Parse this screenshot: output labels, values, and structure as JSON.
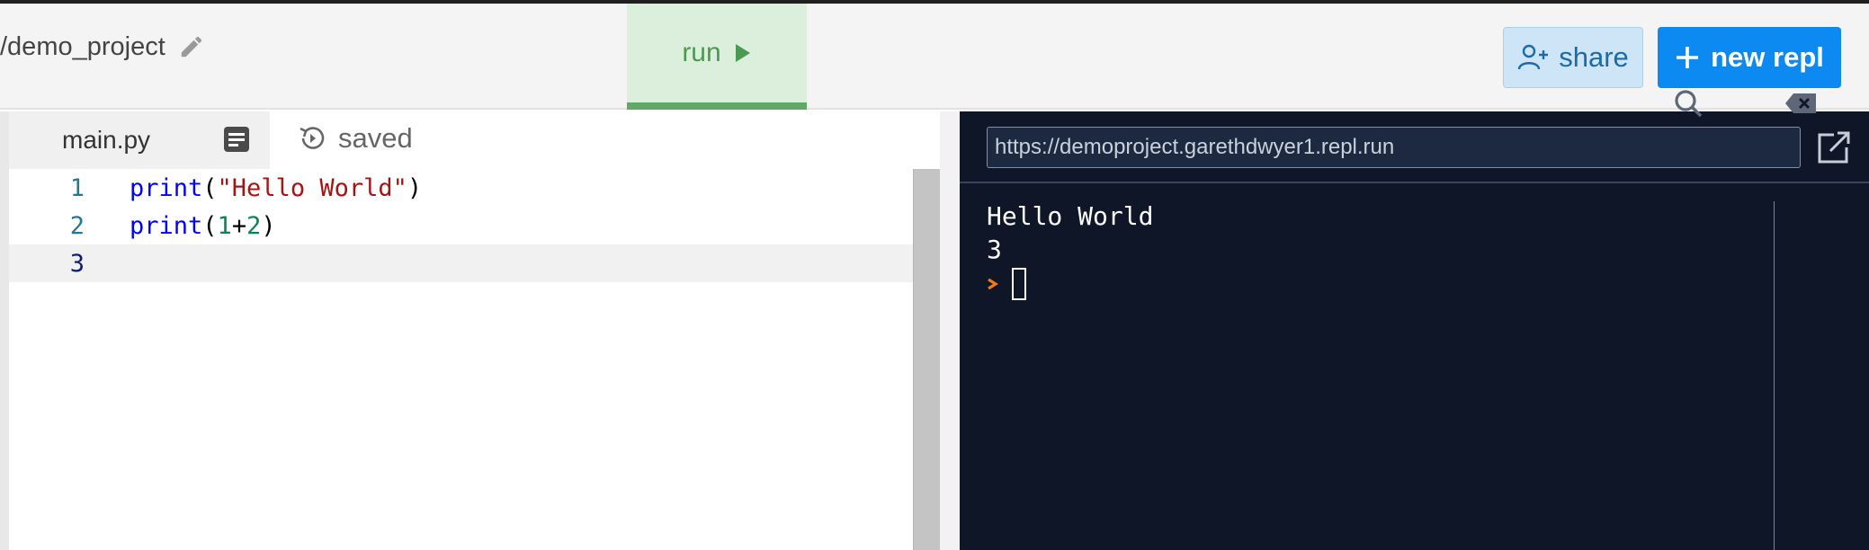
{
  "header": {
    "project_name": "/demo_project",
    "run_label": "run",
    "share_label": "share",
    "new_repl_label": "new repl"
  },
  "editor": {
    "active_file": "main.py",
    "save_status": "saved",
    "lines": [
      {
        "number": "1",
        "tokens": [
          {
            "type": "kw",
            "text": "print"
          },
          {
            "type": "plain",
            "text": "("
          },
          {
            "type": "str",
            "text": "\"Hello World\""
          },
          {
            "type": "plain",
            "text": ")"
          }
        ]
      },
      {
        "number": "2",
        "tokens": [
          {
            "type": "kw",
            "text": "print"
          },
          {
            "type": "plain",
            "text": "("
          },
          {
            "type": "num",
            "text": "1"
          },
          {
            "type": "plain",
            "text": "+"
          },
          {
            "type": "num",
            "text": "2"
          },
          {
            "type": "plain",
            "text": ")"
          }
        ]
      },
      {
        "number": "3",
        "tokens": []
      }
    ],
    "active_line": 3
  },
  "console": {
    "url": "https://demoproject.garethdwyer1.repl.run",
    "output": [
      "Hello World",
      "3"
    ]
  },
  "icons": {
    "project_edit": "pencil-icon",
    "run": "play-icon",
    "share": "user-plus-icon",
    "new_repl": "plus-icon",
    "file_menu": "doc-lines-icon",
    "save_status": "history-icon",
    "open_in_new_tab": "external-link-icon",
    "console_search": "search-icon",
    "console_clear": "backspace-icon",
    "prompt": "chevron-right-icon"
  },
  "colors": {
    "run_bg": "#dcefdc",
    "run_accent": "#5fa865",
    "share_bg": "#cde5f7",
    "new_repl_bg": "#0d8af2",
    "console_bg": "#0e1628",
    "prompt_color": "#f07a1a",
    "keyword": "#0000ff",
    "string": "#a31515",
    "number": "#098658"
  }
}
